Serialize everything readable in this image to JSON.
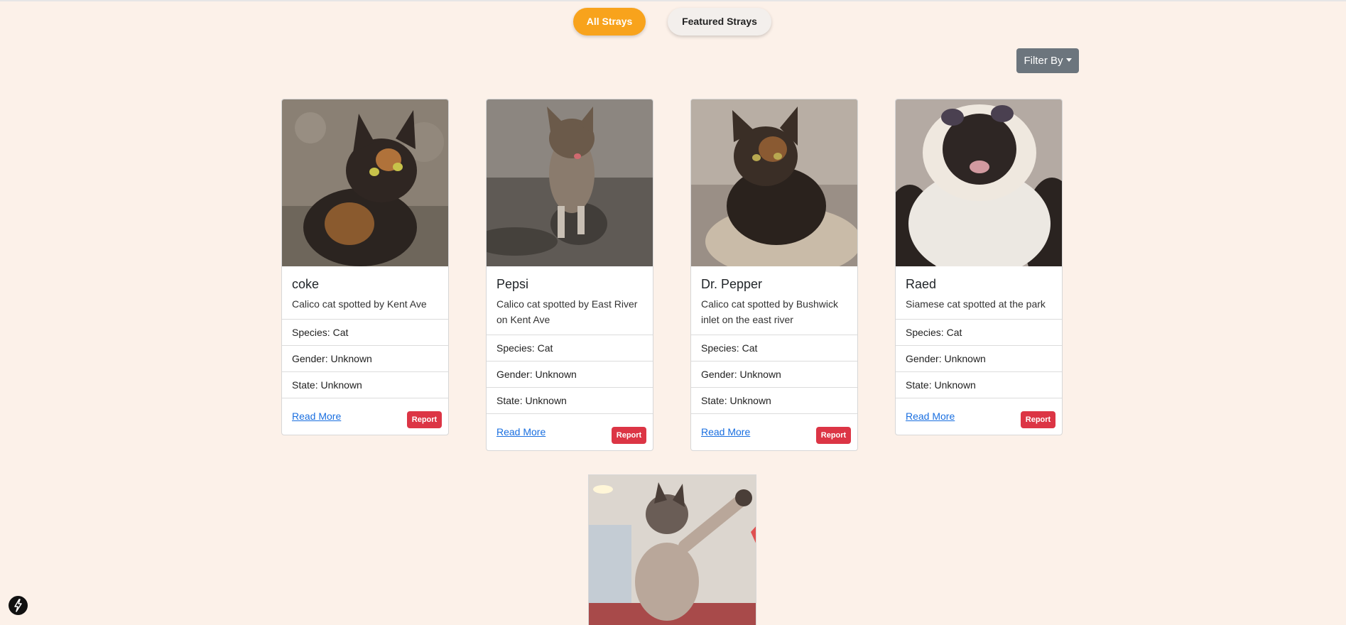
{
  "tabs": {
    "all_strays": "All Strays",
    "featured_strays": "Featured Strays"
  },
  "filter": {
    "label": "Filter By"
  },
  "cards": [
    {
      "name": "coke",
      "description": "Calico cat spotted by Kent Ave",
      "species": "Species: Cat",
      "gender": "Gender: Unknown",
      "state": "State: Unknown",
      "read_more": "Read More",
      "report": "Report"
    },
    {
      "name": "Pepsi",
      "description": "Calico cat spotted by East River on Kent Ave",
      "species": "Species: Cat",
      "gender": "Gender: Unknown",
      "state": "State: Unknown",
      "read_more": "Read More",
      "report": "Report"
    },
    {
      "name": "Dr. Pepper",
      "description": "Calico cat spotted by Bushwick inlet on the east river",
      "species": "Species: Cat",
      "gender": "Gender: Unknown",
      "state": "State: Unknown",
      "read_more": "Read More",
      "report": "Report"
    },
    {
      "name": "Raed",
      "description": "Siamese cat spotted at the park",
      "species": "Species: Cat",
      "gender": "Gender: Unknown",
      "state": "State: Unknown",
      "read_more": "Read More",
      "report": "Report"
    }
  ],
  "colors": {
    "background": "#fcf1e9",
    "active_tab": "#f8a31c",
    "filter_button": "#6c757d",
    "report_button": "#dc3545",
    "link": "#1a6fe0"
  },
  "icons": {
    "floating_button": "lightning-bolt-icon"
  }
}
